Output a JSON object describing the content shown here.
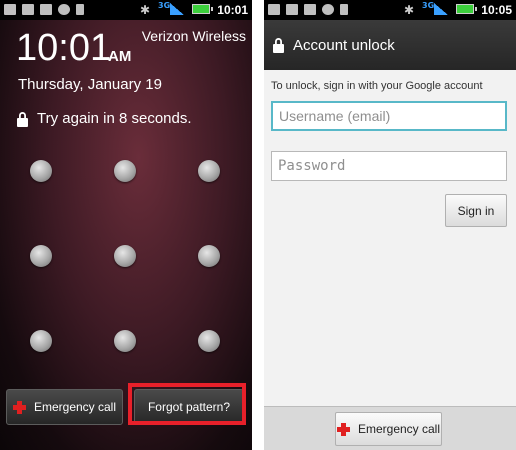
{
  "lockscreen": {
    "time": "10:01",
    "ampm": "AM",
    "carrier": "Verizon Wireless",
    "date": "Thursday, January 19",
    "message": "Try again in 8 seconds.",
    "emergency_label": "Emergency call",
    "forgot_label": "Forgot pattern?"
  },
  "statusbar_left": {
    "time": "10:01",
    "network": "3G"
  },
  "statusbar_right": {
    "time": "10:05",
    "network": "3G"
  },
  "account_unlock": {
    "title": "Account unlock",
    "instruction": "To unlock, sign in with your Google account",
    "username_placeholder": "Username (email)",
    "password_placeholder": "Password",
    "signin_label": "Sign in",
    "emergency_label": "Emergency call"
  },
  "colors": {
    "highlight": "#e8202a",
    "emergency_cross": "#e02020",
    "focus_border": "#58b8c8",
    "battery": "#3ccf3c"
  },
  "icons": [
    "calendar-icon",
    "mail-icon",
    "usb-icon",
    "sync-icon",
    "bluetooth-icon",
    "signal-icon",
    "battery-icon",
    "lock-icon",
    "emergency-cross-icon"
  ]
}
